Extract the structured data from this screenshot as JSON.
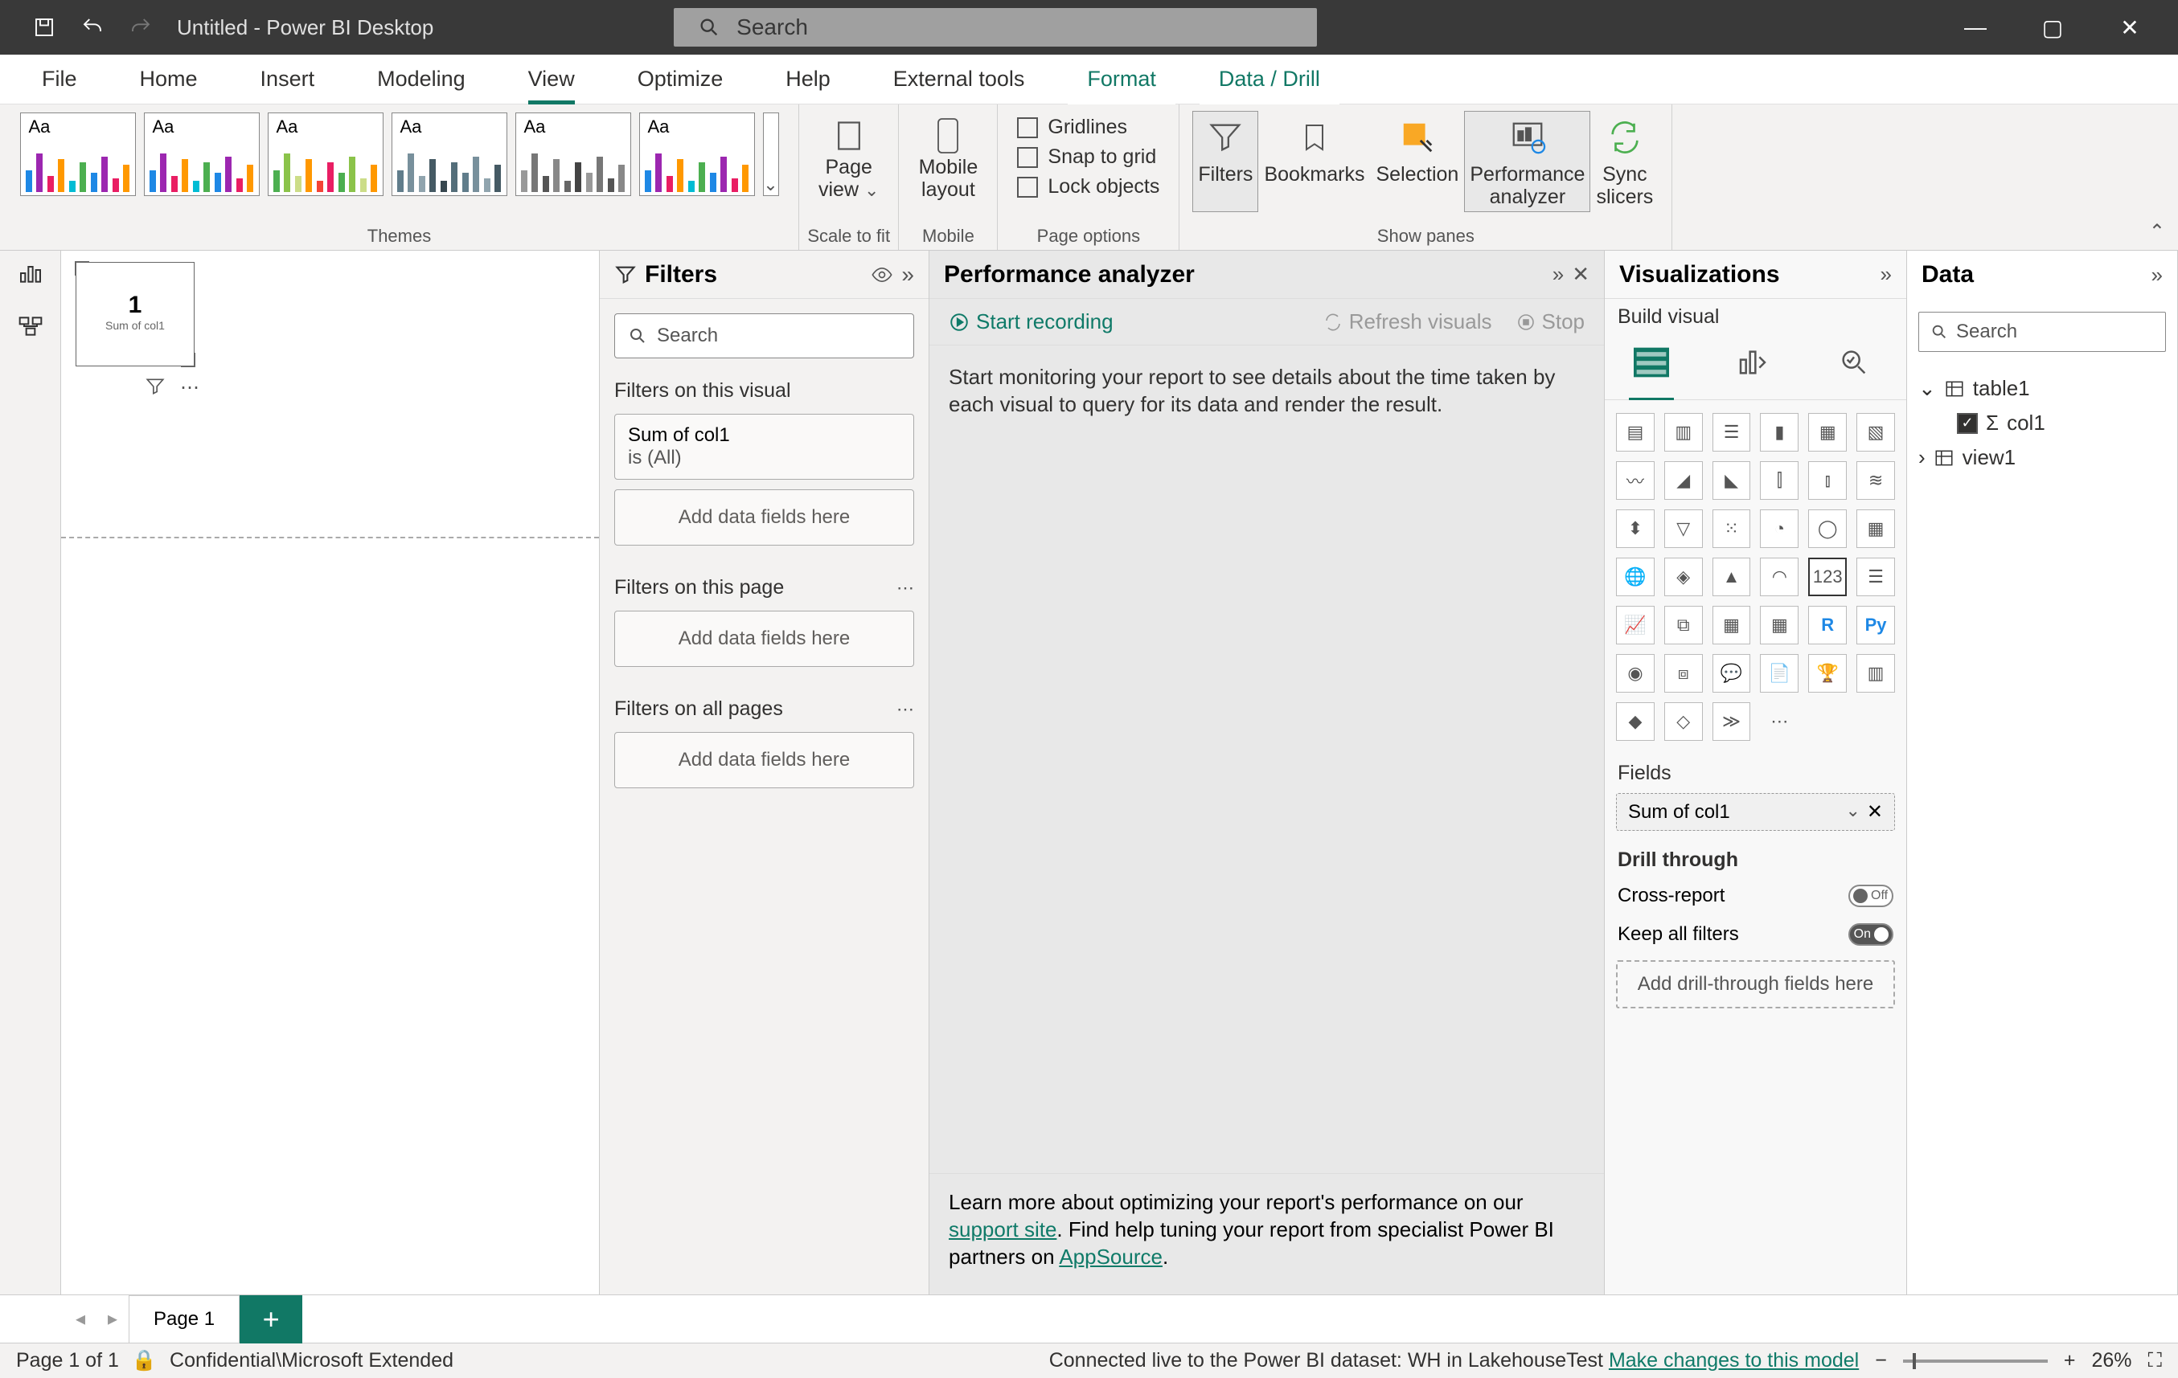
{
  "titlebar": {
    "title": "Untitled - Power BI Desktop",
    "search_placeholder": "Search"
  },
  "tabs": [
    "File",
    "Home",
    "Insert",
    "Modeling",
    "View",
    "Optimize",
    "Help",
    "External tools",
    "Format",
    "Data / Drill"
  ],
  "active_tab": "View",
  "ribbon": {
    "themes_label": "Themes",
    "scale_label": "Scale to fit",
    "page_view": "Page\nview",
    "mobile_label": "Mobile",
    "mobile_layout": "Mobile\nlayout",
    "page_options_label": "Page options",
    "gridlines": "Gridlines",
    "snap_to_grid": "Snap to grid",
    "lock_objects": "Lock objects",
    "show_panes_label": "Show panes",
    "filters": "Filters",
    "bookmarks": "Bookmarks",
    "selection": "Selection",
    "performance_analyzer": "Performance\nanalyzer",
    "sync_slicers": "Sync\nslicers"
  },
  "canvas": {
    "visual_value": "1",
    "visual_caption": "Sum of col1"
  },
  "filters": {
    "title": "Filters",
    "search_placeholder": "Search",
    "section_visual": "Filters on this visual",
    "card_title": "Sum of col1",
    "card_state": "is (All)",
    "add_here": "Add data fields here",
    "section_page": "Filters on this page",
    "section_all": "Filters on all pages"
  },
  "perf": {
    "title": "Performance analyzer",
    "start": "Start recording",
    "refresh": "Refresh visuals",
    "stop": "Stop",
    "body": "Start monitoring your report to see details about the time taken by each visual to query for its data and render the result.",
    "footer1": "Learn more about optimizing your report's performance on our ",
    "support_site": "support site",
    "footer2": ". Find help tuning your report from specialist Power BI partners on ",
    "appsource": "AppSource",
    "footer3": "."
  },
  "viz": {
    "title": "Visualizations",
    "build_visual": "Build visual",
    "fields_label": "Fields",
    "field_pill": "Sum of col1",
    "drill_through": "Drill through",
    "cross_report": "Cross-report",
    "cross_report_state": "Off",
    "keep_all_filters": "Keep all filters",
    "keep_all_state": "On",
    "drill_drop": "Add drill-through fields here"
  },
  "data": {
    "title": "Data",
    "search_placeholder": "Search",
    "table": "table1",
    "col": "col1",
    "view": "view1"
  },
  "page_tabs": {
    "page1": "Page 1"
  },
  "status": {
    "page": "Page 1 of 1",
    "classification": "Confidential\\Microsoft Extended",
    "connection": "Connected live to the Power BI dataset: WH in LakehouseTest ",
    "make_changes": "Make changes to this model",
    "zoom": "26%"
  }
}
